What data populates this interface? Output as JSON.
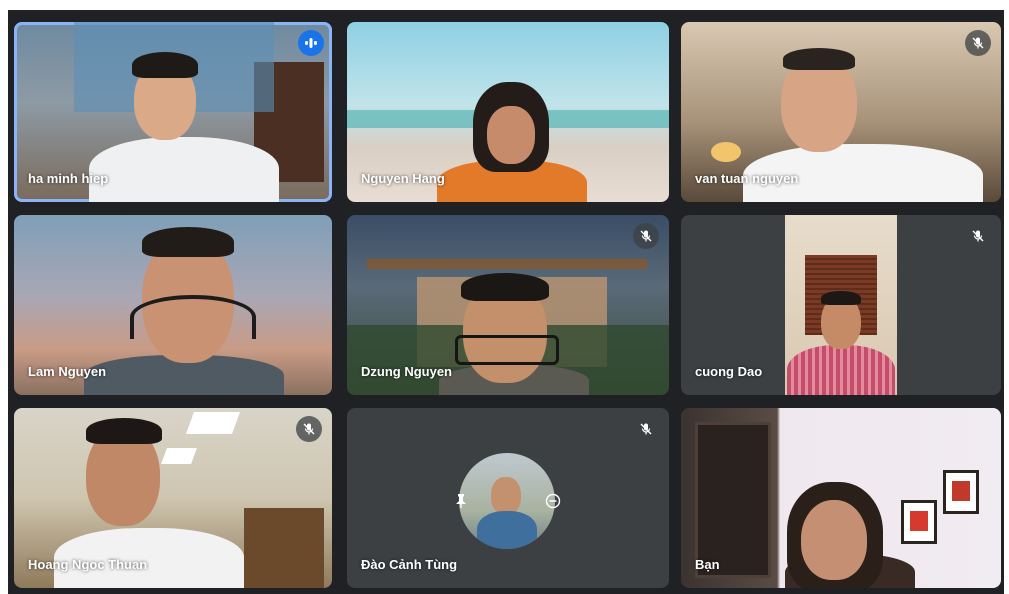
{
  "meeting": {
    "participants": [
      {
        "name": "ha minh hiep",
        "muted": false,
        "speaking": true
      },
      {
        "name": "Nguyen Hang",
        "muted": false,
        "speaking": false
      },
      {
        "name": "van tuan nguyen",
        "muted": true,
        "speaking": false
      },
      {
        "name": "Lam Nguyen",
        "muted": false,
        "speaking": false
      },
      {
        "name": "Dzung Nguyen",
        "muted": true,
        "speaking": false
      },
      {
        "name": "cuong Dao",
        "muted": true,
        "speaking": false
      },
      {
        "name": "Hoang Ngoc Thuan",
        "muted": true,
        "speaking": false
      },
      {
        "name": "Đào Cảnh Tùng",
        "muted": true,
        "speaking": false
      },
      {
        "name": "Bạn",
        "muted": false,
        "speaking": false
      }
    ]
  },
  "icons": {
    "mic_off": "mic-off-icon",
    "speaking": "audio-level-icon",
    "pin": "pin-icon",
    "remove": "remove-icon"
  },
  "colors": {
    "grid_background": "#202124",
    "tile_background": "#3c4043",
    "active_speaker_border": "#8ab4f8",
    "speaking_badge": "#1a73e8"
  }
}
